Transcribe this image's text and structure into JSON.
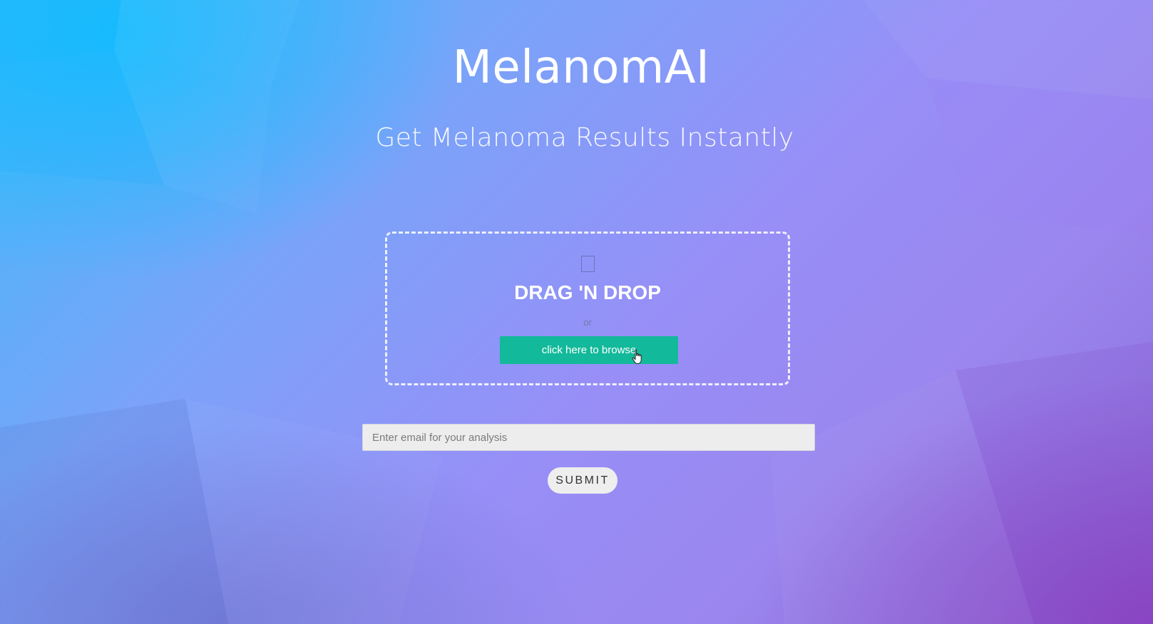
{
  "header": {
    "title": "MelanomAI",
    "subtitle": "Get Melanoma Results Instantly"
  },
  "upload": {
    "icon": "file-icon",
    "drag_label": "DRAG 'N DROP",
    "or_label": "or",
    "browse_label": "click here to browse"
  },
  "form": {
    "email_placeholder": "Enter email for your analysis",
    "email_value": "",
    "submit_label": "SUBMIT"
  },
  "colors": {
    "accent_button": "#13b99b",
    "background_start": "#3ebaf9",
    "background_end": "#8a6bd8"
  }
}
